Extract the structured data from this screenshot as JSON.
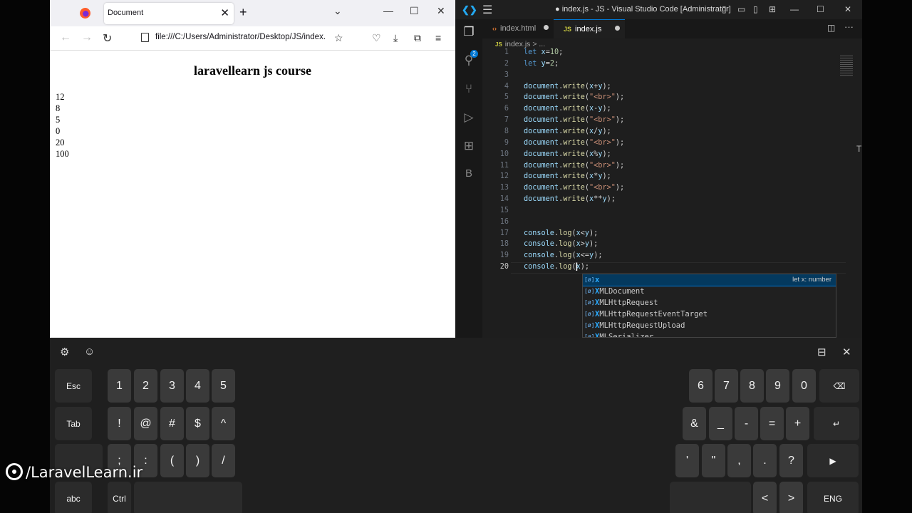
{
  "browser": {
    "tab_title": "Document",
    "url": "file:///C:/Users/Administrator/Desktop/JS/index.",
    "page": {
      "heading": "laravellearn js course",
      "output_lines": [
        "12",
        "8",
        "5",
        "0",
        "20",
        "100"
      ]
    }
  },
  "vscode": {
    "window_title": "● index.js - JS - Visual Studio Code [Administrator]",
    "source_control_badge": "2",
    "activity_b_label": "B",
    "tabs": [
      {
        "label": "index.html",
        "icon": "‹›",
        "icon_color": "#e37933",
        "active": false,
        "dirty": true
      },
      {
        "label": "index.js",
        "icon": "JS",
        "icon_color": "#cbcb41",
        "active": true,
        "dirty": true
      }
    ],
    "breadcrumb": {
      "file": "index.js",
      "sep": ">",
      "rest": "..."
    },
    "current_line": 20,
    "code_lines": [
      [
        {
          "t": "let",
          "c": "kw"
        },
        {
          "t": " "
        },
        {
          "t": "x",
          "c": "vr"
        },
        {
          "t": "="
        },
        {
          "t": "10",
          "c": "nm"
        },
        {
          "t": ";"
        }
      ],
      [
        {
          "t": "let",
          "c": "kw"
        },
        {
          "t": " "
        },
        {
          "t": "y",
          "c": "vr"
        },
        {
          "t": "="
        },
        {
          "t": "2",
          "c": "nm"
        },
        {
          "t": ";"
        }
      ],
      [],
      [
        {
          "t": "document",
          "c": "vr"
        },
        {
          "t": "."
        },
        {
          "t": "write",
          "c": "fn"
        },
        {
          "t": "("
        },
        {
          "t": "x",
          "c": "vr"
        },
        {
          "t": "+"
        },
        {
          "t": "y",
          "c": "vr"
        },
        {
          "t": ");"
        }
      ],
      [
        {
          "t": "document",
          "c": "vr"
        },
        {
          "t": "."
        },
        {
          "t": "write",
          "c": "fn"
        },
        {
          "t": "("
        },
        {
          "t": "\"<br>\"",
          "c": "st"
        },
        {
          "t": ");"
        }
      ],
      [
        {
          "t": "document",
          "c": "vr"
        },
        {
          "t": "."
        },
        {
          "t": "write",
          "c": "fn"
        },
        {
          "t": "("
        },
        {
          "t": "x",
          "c": "vr"
        },
        {
          "t": "-"
        },
        {
          "t": "y",
          "c": "vr"
        },
        {
          "t": ");"
        }
      ],
      [
        {
          "t": "document",
          "c": "vr"
        },
        {
          "t": "."
        },
        {
          "t": "write",
          "c": "fn"
        },
        {
          "t": "("
        },
        {
          "t": "\"<br>\"",
          "c": "st"
        },
        {
          "t": ");"
        }
      ],
      [
        {
          "t": "document",
          "c": "vr"
        },
        {
          "t": "."
        },
        {
          "t": "write",
          "c": "fn"
        },
        {
          "t": "("
        },
        {
          "t": "x",
          "c": "vr"
        },
        {
          "t": "/"
        },
        {
          "t": "y",
          "c": "vr"
        },
        {
          "t": ");"
        }
      ],
      [
        {
          "t": "document",
          "c": "vr"
        },
        {
          "t": "."
        },
        {
          "t": "write",
          "c": "fn"
        },
        {
          "t": "("
        },
        {
          "t": "\"<br>\"",
          "c": "st"
        },
        {
          "t": ");"
        }
      ],
      [
        {
          "t": "document",
          "c": "vr"
        },
        {
          "t": "."
        },
        {
          "t": "write",
          "c": "fn"
        },
        {
          "t": "("
        },
        {
          "t": "x",
          "c": "vr"
        },
        {
          "t": "%"
        },
        {
          "t": "y",
          "c": "vr"
        },
        {
          "t": ");"
        }
      ],
      [
        {
          "t": "document",
          "c": "vr"
        },
        {
          "t": "."
        },
        {
          "t": "write",
          "c": "fn"
        },
        {
          "t": "("
        },
        {
          "t": "\"<br>\"",
          "c": "st"
        },
        {
          "t": ");"
        }
      ],
      [
        {
          "t": "document",
          "c": "vr"
        },
        {
          "t": "."
        },
        {
          "t": "write",
          "c": "fn"
        },
        {
          "t": "("
        },
        {
          "t": "x",
          "c": "vr"
        },
        {
          "t": "*"
        },
        {
          "t": "y",
          "c": "vr"
        },
        {
          "t": ");"
        }
      ],
      [
        {
          "t": "document",
          "c": "vr"
        },
        {
          "t": "."
        },
        {
          "t": "write",
          "c": "fn"
        },
        {
          "t": "("
        },
        {
          "t": "\"<br>\"",
          "c": "st"
        },
        {
          "t": ");"
        }
      ],
      [
        {
          "t": "document",
          "c": "vr"
        },
        {
          "t": "."
        },
        {
          "t": "write",
          "c": "fn"
        },
        {
          "t": "("
        },
        {
          "t": "x",
          "c": "vr"
        },
        {
          "t": "**"
        },
        {
          "t": "y",
          "c": "vr"
        },
        {
          "t": ");"
        }
      ],
      [],
      [],
      [
        {
          "t": "console",
          "c": "vr"
        },
        {
          "t": "."
        },
        {
          "t": "log",
          "c": "fn"
        },
        {
          "t": "("
        },
        {
          "t": "x",
          "c": "vr"
        },
        {
          "t": "<"
        },
        {
          "t": "y",
          "c": "vr"
        },
        {
          "t": ");"
        }
      ],
      [
        {
          "t": "console",
          "c": "vr"
        },
        {
          "t": "."
        },
        {
          "t": "log",
          "c": "fn"
        },
        {
          "t": "("
        },
        {
          "t": "x",
          "c": "vr"
        },
        {
          "t": ">"
        },
        {
          "t": "y",
          "c": "vr"
        },
        {
          "t": ");"
        }
      ],
      [
        {
          "t": "console",
          "c": "vr"
        },
        {
          "t": "."
        },
        {
          "t": "log",
          "c": "fn"
        },
        {
          "t": "("
        },
        {
          "t": "x",
          "c": "vr"
        },
        {
          "t": "<="
        },
        {
          "t": "y",
          "c": "vr"
        },
        {
          "t": ");"
        }
      ],
      [
        {
          "t": "console",
          "c": "vr"
        },
        {
          "t": "."
        },
        {
          "t": "log",
          "c": "fn"
        },
        {
          "t": "("
        },
        {
          "t": "x",
          "c": "vr"
        },
        {
          "t": ");"
        }
      ]
    ],
    "suggestions": [
      {
        "label": "x",
        "match": "x",
        "rest": "",
        "detail": "let x: number",
        "selected": true
      },
      {
        "label": "XMLDocument",
        "match": "X",
        "rest": "MLDocument",
        "detail": "",
        "selected": false
      },
      {
        "label": "XMLHttpRequest",
        "match": "X",
        "rest": "MLHttpRequest",
        "detail": "",
        "selected": false
      },
      {
        "label": "XMLHttpRequestEventTarget",
        "match": "X",
        "rest": "MLHttpRequestEventTarget",
        "detail": "",
        "selected": false
      },
      {
        "label": "XMLHttpRequestUpload",
        "match": "X",
        "rest": "MLHttpRequestUpload",
        "detail": "",
        "selected": false
      },
      {
        "label": "XMLSerializer",
        "match": "X",
        "rest": "MLSerializer",
        "detail": "",
        "selected": false
      }
    ]
  },
  "keyboard": {
    "row1_left": [
      "Esc",
      "1",
      "2",
      "3",
      "4",
      "5"
    ],
    "row1_right": [
      "6",
      "7",
      "8",
      "9",
      "0",
      "⌫"
    ],
    "row2_left": [
      "Tab",
      "!",
      "@",
      "#",
      "$",
      "^"
    ],
    "row2_right": [
      "&",
      "_",
      "-",
      "=",
      "+",
      "↵"
    ],
    "row3_left": [
      "",
      ";",
      ":",
      "(",
      ")",
      "/"
    ],
    "row3_right": [
      "'",
      "\"",
      ",",
      ".",
      "?",
      "▶"
    ],
    "row4_left": [
      "abc",
      "Ctrl",
      ""
    ],
    "row4_right": [
      "",
      "<",
      ">",
      "ENG"
    ]
  },
  "watermark": "/LaravelLearn.ir"
}
